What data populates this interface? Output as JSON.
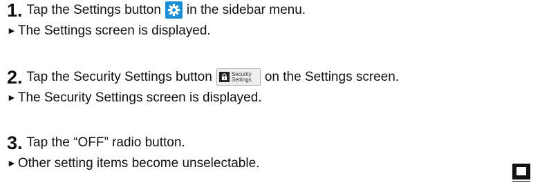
{
  "steps": [
    {
      "number": "1.",
      "text_before": "Tap the Settings button",
      "icon": "gear-icon",
      "text_after": "in the sidebar menu.",
      "result": "The Settings screen is displayed."
    },
    {
      "number": "2.",
      "text_before": "Tap the Security Settings button",
      "icon": "security-settings-icon",
      "icon_label": "Security Settings",
      "text_after": "on the Settings screen.",
      "result": "The Security Settings screen is displayed."
    },
    {
      "number": "3.",
      "text_before": "Tap the “OFF” radio button.",
      "result": "Other setting items become unselectable."
    }
  ],
  "result_marker": "►",
  "colors": {
    "gear_button": "#1a8fd6",
    "text": "#111111"
  },
  "side_icon": "note-icon"
}
